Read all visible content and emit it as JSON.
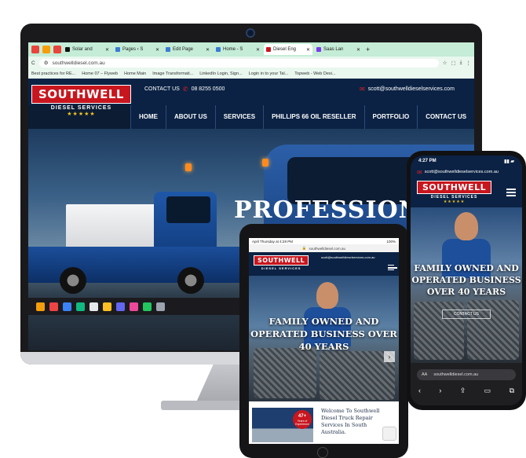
{
  "monitor": {
    "tabs": [
      {
        "label": "",
        "color": "#e8453c"
      },
      {
        "label": "",
        "color": "#f59e0b"
      },
      {
        "label": "",
        "color": "#e8453c"
      },
      {
        "label": "Solar and",
        "color": "#111111"
      },
      {
        "label": "Pages ‹ S",
        "color": "#3a7bd5"
      },
      {
        "label": "Edit Page",
        "color": "#3a7bd5"
      },
      {
        "label": "Home - S",
        "color": "#3a7bd5"
      },
      {
        "label": "Diesel Eng",
        "color": "#c8161e"
      },
      {
        "label": "Saas Lan",
        "color": "#7c3aed"
      }
    ],
    "url": "southwelldiesel.com.au",
    "bookmarks": [
      "Best practices for RE...",
      "Home 07 – Flyweb",
      "Home Main",
      "Image Transformati...",
      "LinkedIn Login, Sign...",
      "Login in to your Tal...",
      "Topweb - Web Desi..."
    ],
    "site": {
      "contact_label": "CONTACT US",
      "phone": "08 8255 0500",
      "email": "scott@southwelldieselservices.com",
      "logo_name": "SOUTHWELL",
      "logo_sub": "DIESEL SERVICES",
      "logo_stars": "★★★★★",
      "nav": [
        "HOME",
        "ABOUT US",
        "SERVICES",
        "PHILLIPS 66 OIL RESELLER",
        "PORTFOLIO",
        "CONTACT US"
      ],
      "hero_title": "PROFESSIONA"
    }
  },
  "tablet": {
    "status_left": "April Thursday at 4:28 PM",
    "status_right": "100%",
    "url": "southwelldiesel.com.au",
    "email": "scott@southwelldieselservices.com.au",
    "logo_name": "SOUTHWELL",
    "logo_sub": "DIESEL SERVICES",
    "hero_title": "FAMILY OWNED AND OPERATED BUSINESS OVER 40 YEARS",
    "badge_number": "47+",
    "badge_text": "Years of Experience",
    "welcome_text": "Welcome To Southwell Diesel Truck Repair Services In South Australia."
  },
  "phone": {
    "time": "4:27 PM",
    "email": "scott@southwelldieselservices.com.au",
    "logo_name": "SOUTHWELL",
    "logo_sub": "DIESEL SERVICES",
    "logo_stars": "★★★★★",
    "hero_title": "FAMILY OWNED AND OPERATED BUSINESS OVER 40 YEARS",
    "cta": "CONTACT US",
    "url": "southwelldiesel.com.au",
    "aa": "AA"
  },
  "colors": {
    "brand_red": "#c8161e",
    "brand_navy": "#0b2244",
    "tab_bar": "#c4ecd6",
    "star_gold": "#f2c224"
  }
}
